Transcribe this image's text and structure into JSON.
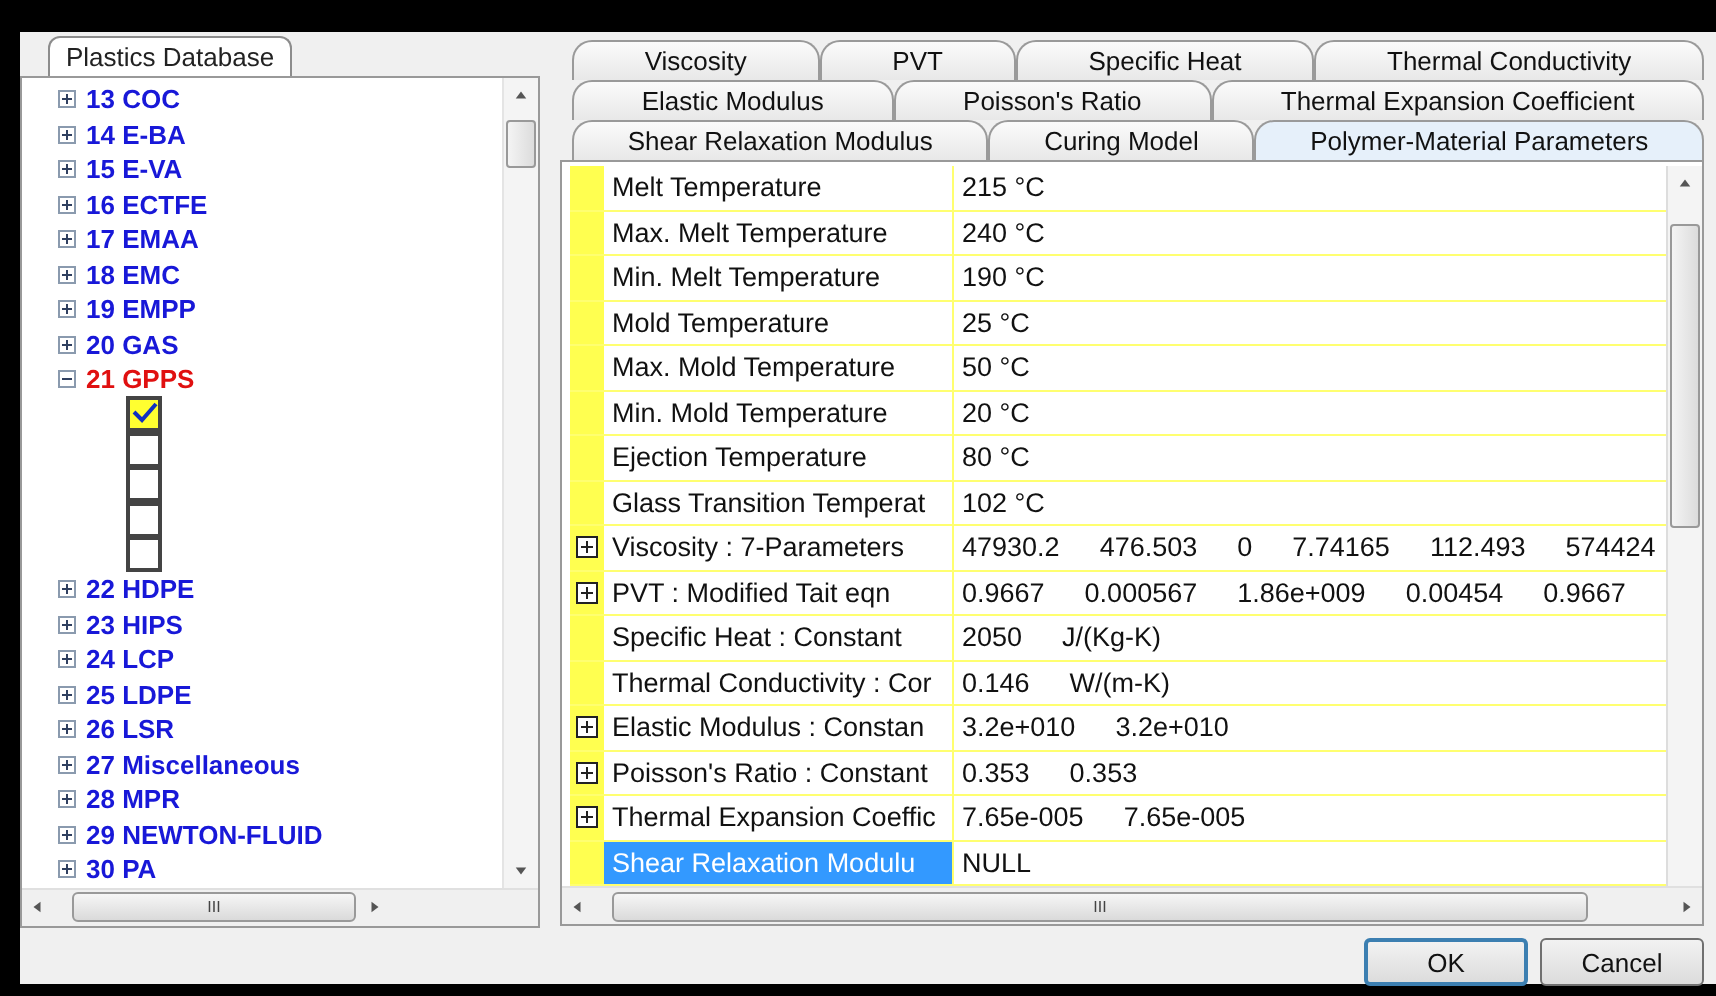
{
  "left_panel": {
    "tab": {
      "label": "Plastics Database"
    },
    "tree": [
      {
        "label": "13 COC",
        "expanded": false,
        "selected": false
      },
      {
        "label": "14 E-BA",
        "expanded": false,
        "selected": false
      },
      {
        "label": "15 E-VA",
        "expanded": false,
        "selected": false
      },
      {
        "label": "16 ECTFE",
        "expanded": false,
        "selected": false
      },
      {
        "label": "17 EMAA",
        "expanded": false,
        "selected": false
      },
      {
        "label": "18 EMC",
        "expanded": false,
        "selected": false
      },
      {
        "label": "19 EMPP",
        "expanded": false,
        "selected": false
      },
      {
        "label": "20 GAS",
        "expanded": false,
        "selected": false
      },
      {
        "label": "21 GPPS",
        "expanded": true,
        "selected": true,
        "children": [
          {
            "checked": true
          },
          {
            "checked": false
          },
          {
            "checked": false
          },
          {
            "checked": false
          },
          {
            "checked": false
          }
        ]
      },
      {
        "label": "22 HDPE",
        "expanded": false,
        "selected": false
      },
      {
        "label": "23 HIPS",
        "expanded": false,
        "selected": false
      },
      {
        "label": "24 LCP",
        "expanded": false,
        "selected": false
      },
      {
        "label": "25 LDPE",
        "expanded": false,
        "selected": false
      },
      {
        "label": "26 LSR",
        "expanded": false,
        "selected": false
      },
      {
        "label": "27 Miscellaneous",
        "expanded": false,
        "selected": false
      },
      {
        "label": "28 MPR",
        "expanded": false,
        "selected": false
      },
      {
        "label": "29 NEWTON-FLUID",
        "expanded": false,
        "selected": false
      },
      {
        "label": "30 PA",
        "expanded": false,
        "selected": false
      }
    ],
    "scrollbar_label": "III"
  },
  "tab_rows": [
    [
      {
        "label": "Viscosity",
        "selected": false
      },
      {
        "label": "PVT",
        "selected": false
      },
      {
        "label": "Specific Heat",
        "selected": false
      },
      {
        "label": "Thermal Conductivity",
        "selected": false
      }
    ],
    [
      {
        "label": "Elastic Modulus",
        "selected": false
      },
      {
        "label": "Poisson's Ratio",
        "selected": false
      },
      {
        "label": "Thermal Expansion Coefficient",
        "selected": false
      }
    ],
    [
      {
        "label": "Shear Relaxation Modulus",
        "selected": false
      },
      {
        "label": "Curing Model",
        "selected": false
      },
      {
        "label": "Polymer-Material Parameters",
        "selected": true
      }
    ]
  ],
  "grid": {
    "rows": [
      {
        "name": "Melt Temperature",
        "values": [
          "215 °C"
        ],
        "expandable": false,
        "selected": false
      },
      {
        "name": "Max. Melt Temperature",
        "values": [
          "240 °C"
        ],
        "expandable": false,
        "selected": false
      },
      {
        "name": "Min. Melt Temperature",
        "values": [
          "190 °C"
        ],
        "expandable": false,
        "selected": false
      },
      {
        "name": "Mold Temperature",
        "values": [
          "25 °C"
        ],
        "expandable": false,
        "selected": false
      },
      {
        "name": "Max. Mold Temperature",
        "values": [
          "50 °C"
        ],
        "expandable": false,
        "selected": false
      },
      {
        "name": "Min. Mold Temperature",
        "values": [
          "20 °C"
        ],
        "expandable": false,
        "selected": false
      },
      {
        "name": "Ejection Temperature",
        "values": [
          "80 °C"
        ],
        "expandable": false,
        "selected": false
      },
      {
        "name": "Glass Transition Temperat",
        "values": [
          "102 °C"
        ],
        "expandable": false,
        "selected": false
      },
      {
        "name": "Viscosity : 7-Parameters",
        "values": [
          "47930.2",
          "476.503",
          "0",
          "7.74165",
          "112.493",
          "574424"
        ],
        "expandable": true,
        "selected": false
      },
      {
        "name": "PVT : Modified Tait eqn",
        "values": [
          "0.9667",
          "0.000567",
          "1.86e+009",
          "0.00454",
          "0.9667"
        ],
        "expandable": true,
        "selected": false
      },
      {
        "name": "Specific Heat : Constant",
        "values": [
          "2050",
          "J/(Kg-K)"
        ],
        "expandable": false,
        "selected": false
      },
      {
        "name": "Thermal Conductivity : Cor",
        "values": [
          "0.146",
          "W/(m-K)"
        ],
        "expandable": false,
        "selected": false
      },
      {
        "name": "Elastic Modulus : Constan",
        "values": [
          "3.2e+010",
          "3.2e+010"
        ],
        "expandable": true,
        "selected": false
      },
      {
        "name": "Poisson's Ratio : Constant",
        "values": [
          "0.353",
          "0.353"
        ],
        "expandable": true,
        "selected": false
      },
      {
        "name": "Thermal Expansion Coeffic",
        "values": [
          "7.65e-005",
          "7.65e-005"
        ],
        "expandable": true,
        "selected": false
      },
      {
        "name": "Shear Relaxation Modulu",
        "values": [
          "NULL"
        ],
        "expandable": false,
        "selected": true
      }
    ],
    "scrollbar_label": "III"
  },
  "buttons": [
    {
      "label": "OK",
      "focused": true
    },
    {
      "label": "Cancel",
      "focused": false
    }
  ]
}
